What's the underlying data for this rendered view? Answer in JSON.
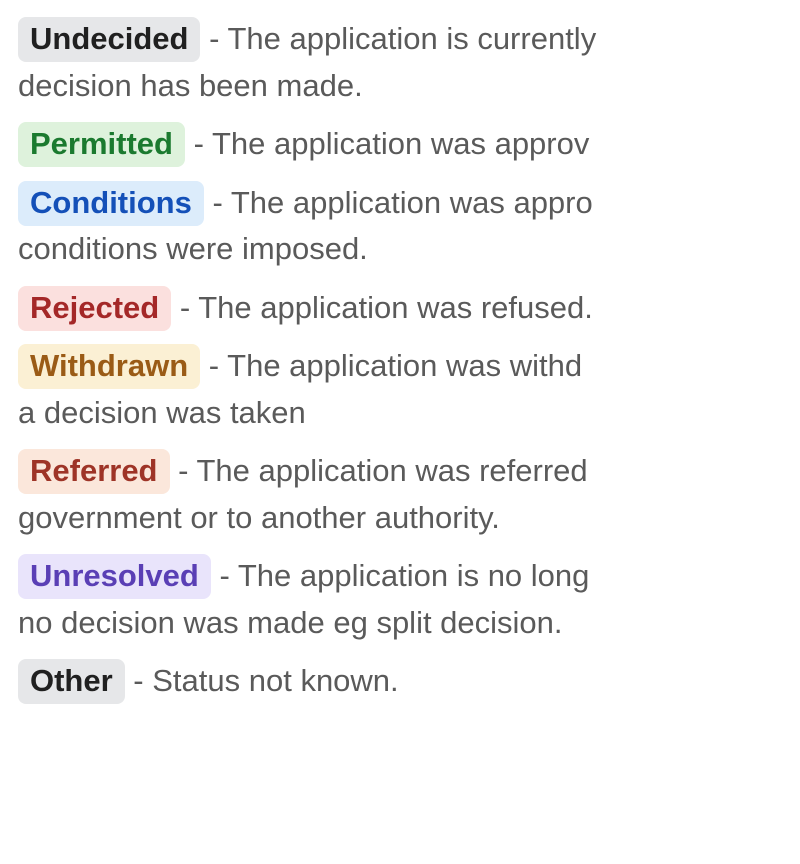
{
  "statuses": [
    {
      "label": "Undecided",
      "color": "gray",
      "desc_first": " - The application is currently",
      "desc_cont": "decision has been made."
    },
    {
      "label": "Permitted",
      "color": "green",
      "desc_first": " - The application was approv",
      "desc_cont": ""
    },
    {
      "label": "Conditions",
      "color": "blue",
      "desc_first": " - The application was appro",
      "desc_cont": "conditions were imposed."
    },
    {
      "label": "Rejected",
      "color": "red",
      "desc_first": " - The application was refused.",
      "desc_cont": ""
    },
    {
      "label": "Withdrawn",
      "color": "yellow",
      "desc_first": " - The application was withd",
      "desc_cont": "a decision was taken"
    },
    {
      "label": "Referred",
      "color": "orange",
      "desc_first": " - The application was referred",
      "desc_cont": "government or to another authority."
    },
    {
      "label": "Unresolved",
      "color": "purple",
      "desc_first": " - The application is no long",
      "desc_cont": "no decision was made eg split decision."
    },
    {
      "label": "Other",
      "color": "gray",
      "desc_first": " - Status not known.",
      "desc_cont": ""
    }
  ]
}
